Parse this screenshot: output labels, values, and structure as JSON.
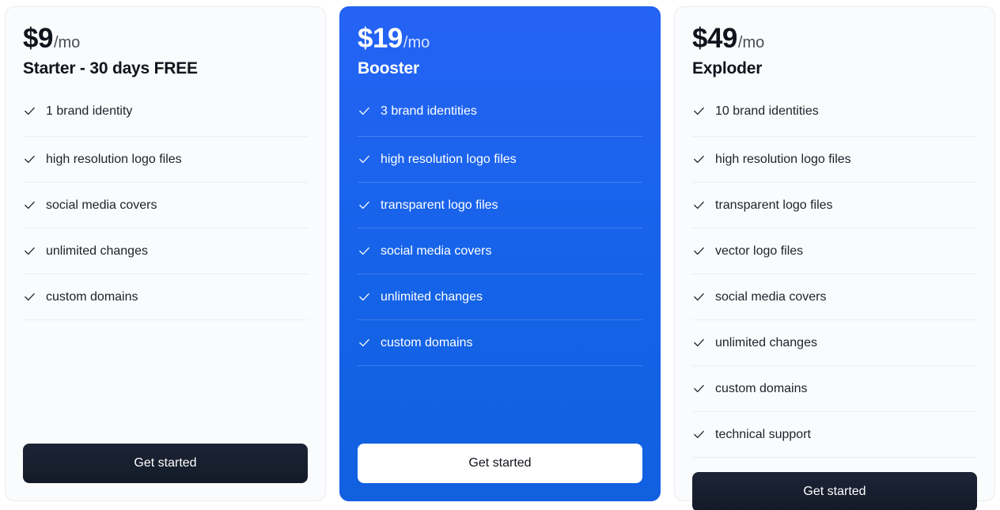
{
  "plans": [
    {
      "price_amount": "$9",
      "price_period": "/mo",
      "name": "Starter - 30 days FREE",
      "highlighted": false,
      "cta_label": "Get started",
      "features": [
        "1 brand identity",
        "high resolution logo files",
        "social media covers",
        "unlimited changes",
        "custom domains"
      ]
    },
    {
      "price_amount": "$19",
      "price_period": "/mo",
      "name": "Booster",
      "highlighted": true,
      "cta_label": "Get started",
      "features": [
        "3 brand identities",
        "high resolution logo files",
        "transparent logo files",
        "social media covers",
        "unlimited changes",
        "custom domains"
      ]
    },
    {
      "price_amount": "$49",
      "price_period": "/mo",
      "name": "Exploder",
      "highlighted": false,
      "cta_label": "Get started",
      "features": [
        "10 brand identities",
        "high resolution logo files",
        "transparent logo files",
        "vector logo files",
        "social media covers",
        "unlimited changes",
        "custom domains",
        "technical support"
      ]
    }
  ],
  "icons": {
    "check": "check-icon"
  },
  "colors": {
    "accent_blue": "#1563e8",
    "card_background": "#fafbfc",
    "card_border": "#e9ecef",
    "dark_button": "#151b28",
    "text_primary": "#10141c",
    "divider": "#ebedf0"
  }
}
